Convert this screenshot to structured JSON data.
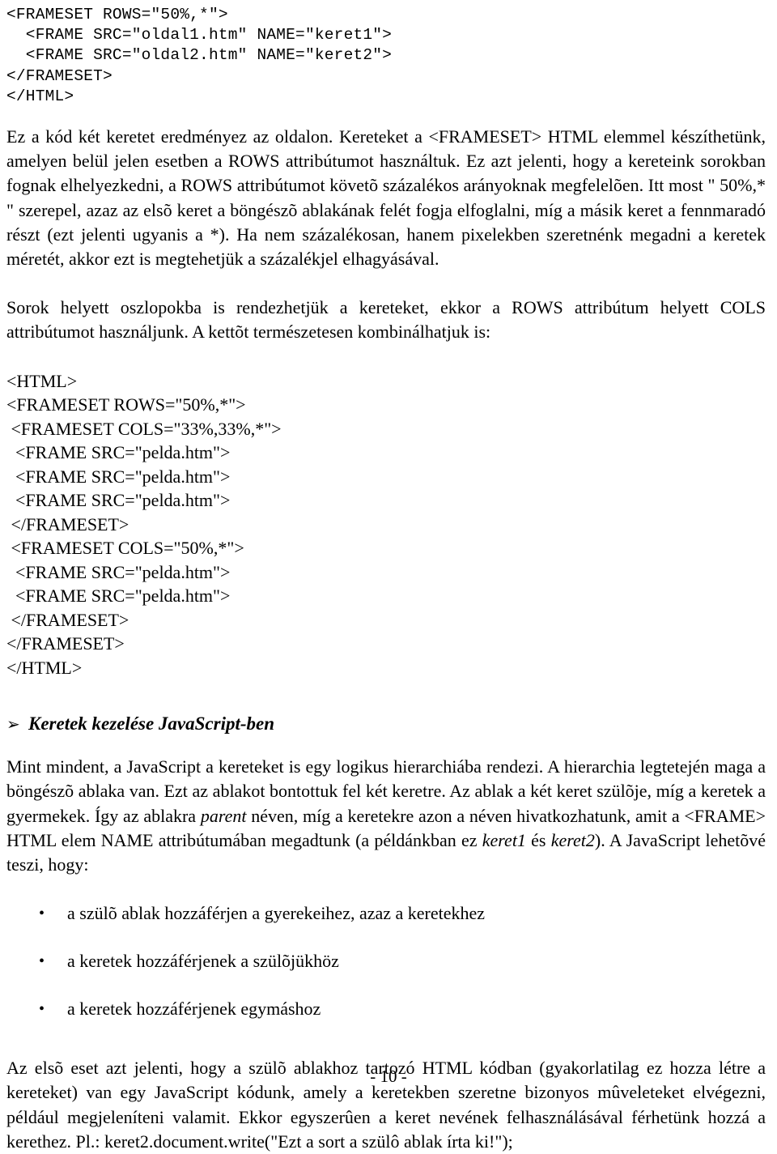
{
  "document": {
    "page_number": "- 10 -"
  },
  "code_block_1": {
    "lines": [
      "<FRAMESET ROWS=\"50%,*\">",
      "  <FRAME SRC=\"oldal1.htm\" NAME=\"keret1\">",
      "  <FRAME SRC=\"oldal2.htm\" NAME=\"keret2\">",
      "</FRAMESET>",
      "</HTML>"
    ]
  },
  "paragraph_1": "Ez a kód két keretet eredményez az oldalon. Kereteket a <FRAMESET> HTML elemmel készíthetünk, amelyen belül jelen esetben a ROWS attribútumot használtuk. Ez azt jelenti, hogy a kereteink sorokban fognak elhelyezkedni, a ROWS attribútumot követõ százalékos arányoknak megfelelõen. Itt most \" 50%,* \" szerepel, azaz az elsõ keret a böngészõ ablakának felét fogja elfoglalni, míg a másik keret a fennmaradó részt (ezt jelenti ugyanis a *). Ha nem százalékosan, hanem pixelekben szeretnénk megadni a keretek méretét, akkor ezt is megtehetjük a százalékjel elhagyásával.",
  "paragraph_2": "Sorok helyett oszlopokba is rendezhetjük a kereteket, ekkor a ROWS attribútum helyett COLS attribútumot használjunk. A kettõt természetesen kombinálhatjuk is:",
  "code_block_2": {
    "lines": [
      "<HTML>",
      "<FRAMESET ROWS=\"50%,*\">",
      " <FRAMESET COLS=\"33%,33%,*\">",
      "  <FRAME SRC=\"pelda.htm\">",
      "  <FRAME SRC=\"pelda.htm\">",
      "  <FRAME SRC=\"pelda.htm\">",
      " </FRAMESET>",
      " <FRAMESET COLS=\"50%,*\">",
      "  <FRAME SRC=\"pelda.htm\">",
      "  <FRAME SRC=\"pelda.htm\">",
      " </FRAMESET>",
      "</FRAMESET>",
      "</HTML>"
    ]
  },
  "heading": {
    "marker": "➢",
    "text": "Keretek kezelése JavaScript-ben"
  },
  "paragraph_3": {
    "part_1": "Mint mindent, a JavaScript a kereteket is egy logikus hierarchiába rendezi. A hierarchia legtetején maga a böngészõ ablaka van. Ezt az ablakot bontottuk fel két keretre. Az ablak a két keret szülõje, míg a keretek a gyermekek. Így az ablakra ",
    "italic_1": "parent",
    "part_2": " néven, míg a keretekre azon a néven hivatkozhatunk, amit a <FRAME> HTML elem NAME attribútumában megadtunk (a példánkban ez ",
    "italic_2": "keret1",
    "part_3": " és ",
    "italic_3": "keret2",
    "part_4": "). A JavaScript lehetõvé teszi, hogy:"
  },
  "bullet_list": {
    "marker": "•",
    "items": [
      "a szülõ ablak hozzáférjen a gyerekeihez, azaz a keretekhez",
      "a keretek hozzáférjenek a szülõjükhöz",
      "a keretek hozzáférjenek egymáshoz"
    ]
  },
  "paragraph_4": "Az elsõ eset azt jelenti, hogy a szülõ ablakhoz tartozó HTML kódban (gyakorlatilag ez hozza létre a kereteket) van egy JavaScript kódunk, amely a keretekben szeretne bizonyos mûveleteket elvégezni, például megjeleníteni valamit. Ekkor egyszerûen a keret nevének felhasználásával férhetünk hozzá a kerethez. Pl.: keret2.document.write(\"Ezt a sort a szülô ablak írta ki!\");"
}
